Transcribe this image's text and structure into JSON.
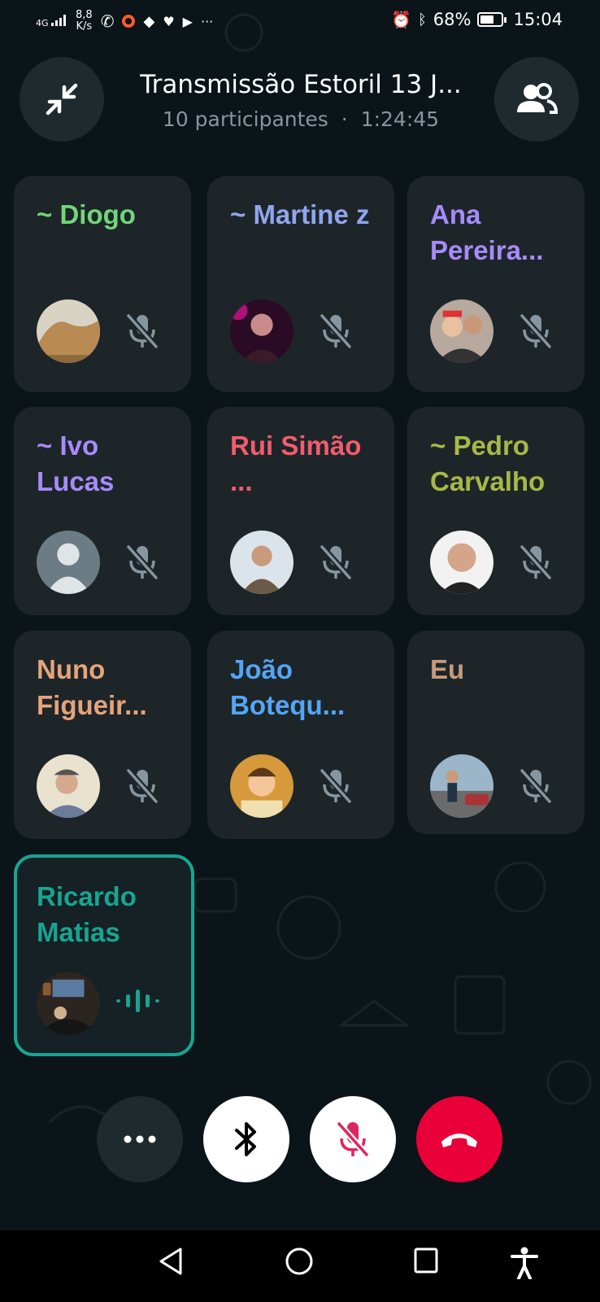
{
  "status_bar": {
    "network_label": "4G",
    "speed_value": "8,8",
    "speed_unit": "K/s",
    "battery": "68%",
    "battery_level": 0.68,
    "time": "15:04"
  },
  "header": {
    "title": "Transmissão Estoril 13 J...",
    "participants": "10 participantes",
    "separator": "·",
    "duration": "1:24:45"
  },
  "participants": [
    {
      "name": "~ Diogo",
      "color": "#71d57a",
      "avatar": "photo-cliff",
      "muted": true
    },
    {
      "name": "~ Martine z",
      "color": "#8fa5ee",
      "avatar": "photo-pink",
      "muted": true
    },
    {
      "name": "Ana Pereira...",
      "color": "#a78bfa",
      "avatar": "photo-couple",
      "muted": true
    },
    {
      "name": "~ Ivo Lucas",
      "color": "#a78bfa",
      "avatar": "default-avatar",
      "muted": true
    },
    {
      "name": "Rui Simão ...",
      "color": "#f15c6d",
      "avatar": "photo-man-hoodie",
      "muted": true
    },
    {
      "name": "~ Pedro Carvalho",
      "color": "#a8b846",
      "avatar": "photo-man-bald",
      "muted": true
    },
    {
      "name": "Nuno Figueir...",
      "color": "#e6a37a",
      "avatar": "photo-man-cap",
      "muted": true
    },
    {
      "name": "João Botequ...",
      "color": "#53a6f4",
      "avatar": "photo-cartoon",
      "muted": true
    },
    {
      "name": "Eu",
      "color": "#c89a7a",
      "avatar": "photo-cars",
      "muted": true
    },
    {
      "name": "Ricardo Matias",
      "color": "#17a592",
      "avatar": "photo-studio",
      "muted": false,
      "speaking": true
    }
  ],
  "controls": {
    "more": "more-options",
    "bluetooth": "bluetooth",
    "mute": "mic-off",
    "end": "end-call"
  },
  "colors": {
    "accent": "#17a592",
    "end_call": "#ea0038",
    "tile_bg": "#1d2529"
  }
}
